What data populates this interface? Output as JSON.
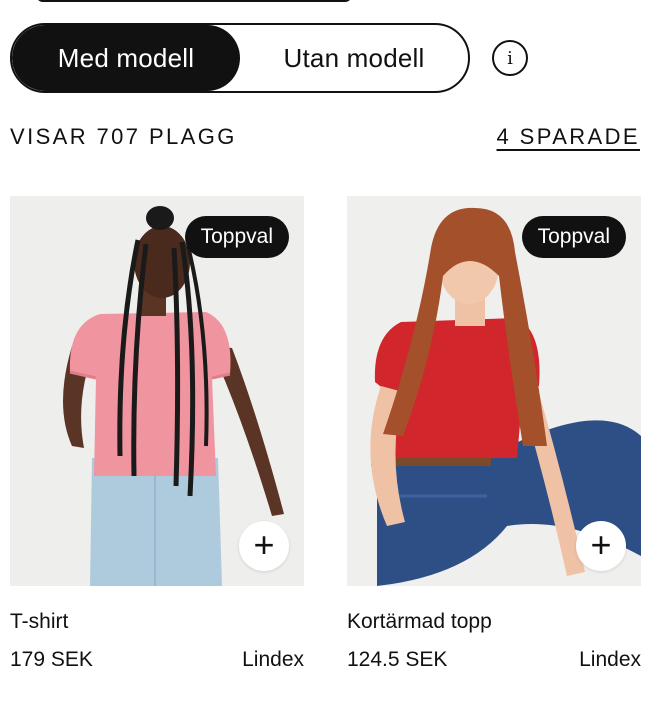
{
  "toggle": {
    "with_model": "Med modell",
    "without_model": "Utan modell",
    "selected": "Med modell"
  },
  "info_icon": "info-icon",
  "summary": {
    "count_text": "VISAR 707 PLAGG",
    "saved_text": "4 SPARADE"
  },
  "products": [
    {
      "badge": "Toppval",
      "name": "T-shirt",
      "price": "179 SEK",
      "brand": "Lindex",
      "add_icon": "plus-icon"
    },
    {
      "badge": "Toppval",
      "name": "Kortärmad topp",
      "price": "124.5 SEK",
      "brand": "Lindex",
      "add_icon": "plus-icon"
    }
  ],
  "colors": {
    "primary": "#111111",
    "background": "#ffffff"
  }
}
